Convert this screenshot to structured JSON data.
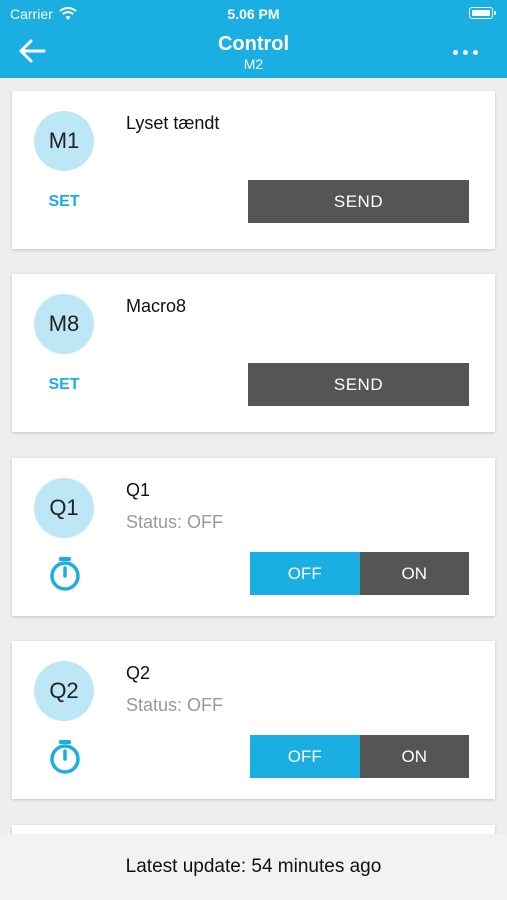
{
  "status_bar": {
    "carrier": "Carrier",
    "time": "5.06 PM"
  },
  "header": {
    "title": "Control",
    "subtitle": "M2"
  },
  "colors": {
    "accent": "#1aaee3",
    "dark_button": "#555555",
    "avatar_bg": "#bde6f7"
  },
  "macros": [
    {
      "badge": "M1",
      "name": "Lyset tændt",
      "set_label": "SET",
      "send_label": "SEND"
    },
    {
      "badge": "M8",
      "name": "Macro8",
      "set_label": "SET",
      "send_label": "SEND"
    }
  ],
  "outputs": [
    {
      "badge": "Q1",
      "name": "Q1",
      "status": "Status: OFF",
      "off_label": "OFF",
      "on_label": "ON",
      "selected": "OFF"
    },
    {
      "badge": "Q2",
      "name": "Q2",
      "status": "Status: OFF",
      "off_label": "OFF",
      "on_label": "ON",
      "selected": "OFF"
    }
  ],
  "footer": {
    "text": "Latest update: 54 minutes ago"
  }
}
